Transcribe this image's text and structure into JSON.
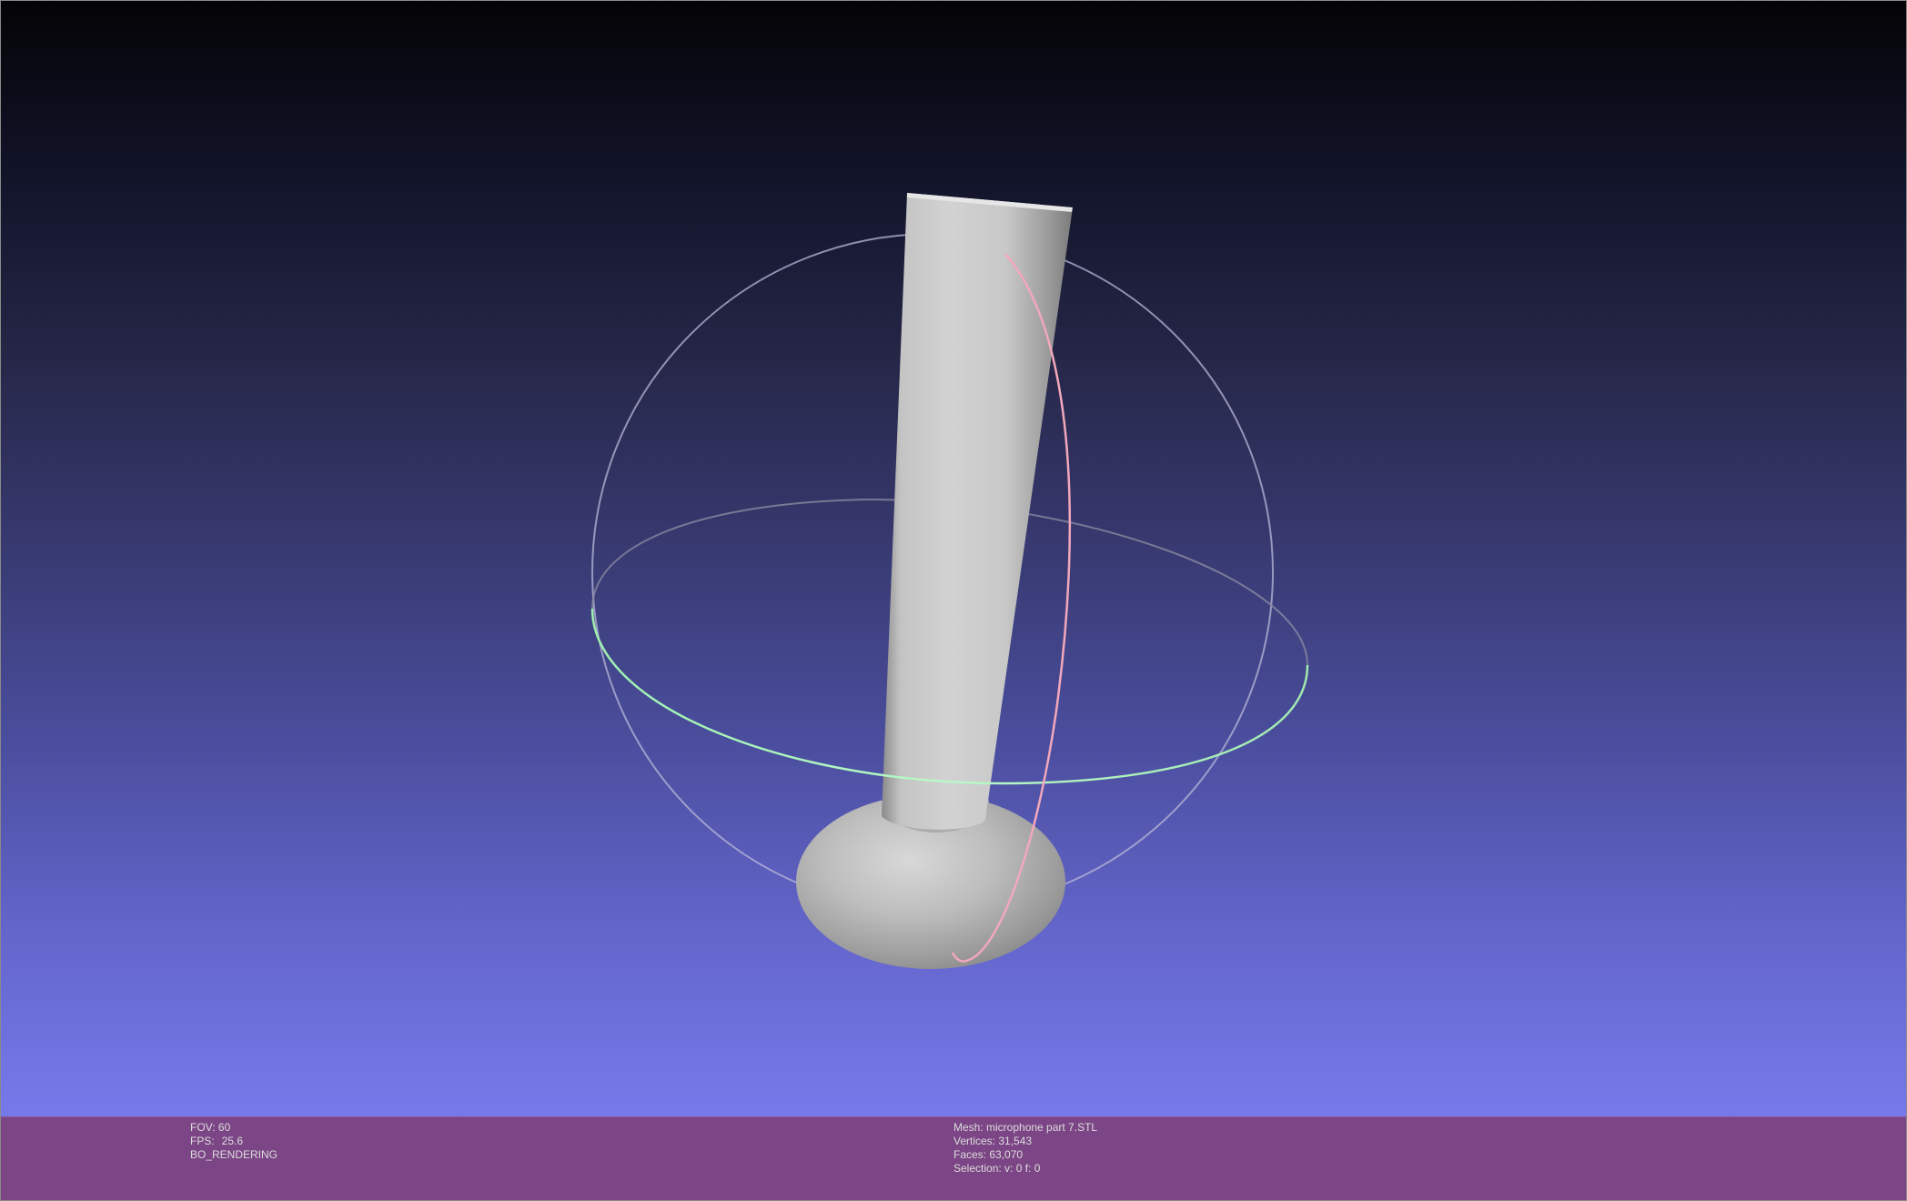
{
  "viewport": {
    "scene": "3D mesh view",
    "trackball": {
      "horizontal_ring_color": "#a8f0b8",
      "vertical_ring_color": "#f0a8b8",
      "outer_ring_color": "#b8b8d8"
    },
    "mesh_color": "#c8c8c8"
  },
  "status_left": {
    "fov": "FOV: 60",
    "fps_label": "FPS:",
    "fps_value": "25.6",
    "render_mode": "BO_RENDERING"
  },
  "status_right": {
    "mesh": "Mesh: microphone part 7.STL",
    "vertices": "Vertices: 31,543",
    "faces": "Faces: 63,070",
    "selection": "Selection: v: 0 f: 0"
  },
  "colors": {
    "status_bar": "#7c4686",
    "status_text": "#dcdcdc"
  }
}
